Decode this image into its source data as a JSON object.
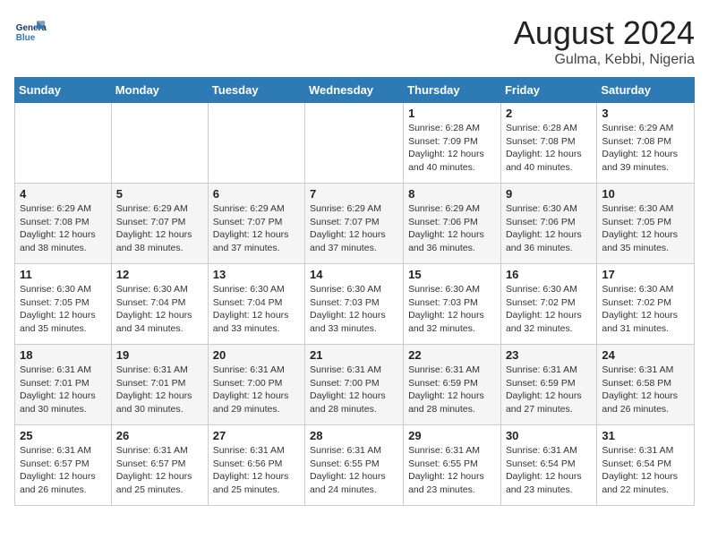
{
  "header": {
    "logo_line1": "General",
    "logo_line2": "Blue",
    "month_year": "August 2024",
    "location": "Gulma, Kebbi, Nigeria"
  },
  "days_of_week": [
    "Sunday",
    "Monday",
    "Tuesday",
    "Wednesday",
    "Thursday",
    "Friday",
    "Saturday"
  ],
  "weeks": [
    [
      {
        "day": "",
        "info": ""
      },
      {
        "day": "",
        "info": ""
      },
      {
        "day": "",
        "info": ""
      },
      {
        "day": "",
        "info": ""
      },
      {
        "day": "1",
        "info": "Sunrise: 6:28 AM\nSunset: 7:09 PM\nDaylight: 12 hours\nand 40 minutes."
      },
      {
        "day": "2",
        "info": "Sunrise: 6:28 AM\nSunset: 7:08 PM\nDaylight: 12 hours\nand 40 minutes."
      },
      {
        "day": "3",
        "info": "Sunrise: 6:29 AM\nSunset: 7:08 PM\nDaylight: 12 hours\nand 39 minutes."
      }
    ],
    [
      {
        "day": "4",
        "info": "Sunrise: 6:29 AM\nSunset: 7:08 PM\nDaylight: 12 hours\nand 38 minutes."
      },
      {
        "day": "5",
        "info": "Sunrise: 6:29 AM\nSunset: 7:07 PM\nDaylight: 12 hours\nand 38 minutes."
      },
      {
        "day": "6",
        "info": "Sunrise: 6:29 AM\nSunset: 7:07 PM\nDaylight: 12 hours\nand 37 minutes."
      },
      {
        "day": "7",
        "info": "Sunrise: 6:29 AM\nSunset: 7:07 PM\nDaylight: 12 hours\nand 37 minutes."
      },
      {
        "day": "8",
        "info": "Sunrise: 6:29 AM\nSunset: 7:06 PM\nDaylight: 12 hours\nand 36 minutes."
      },
      {
        "day": "9",
        "info": "Sunrise: 6:30 AM\nSunset: 7:06 PM\nDaylight: 12 hours\nand 36 minutes."
      },
      {
        "day": "10",
        "info": "Sunrise: 6:30 AM\nSunset: 7:05 PM\nDaylight: 12 hours\nand 35 minutes."
      }
    ],
    [
      {
        "day": "11",
        "info": "Sunrise: 6:30 AM\nSunset: 7:05 PM\nDaylight: 12 hours\nand 35 minutes."
      },
      {
        "day": "12",
        "info": "Sunrise: 6:30 AM\nSunset: 7:04 PM\nDaylight: 12 hours\nand 34 minutes."
      },
      {
        "day": "13",
        "info": "Sunrise: 6:30 AM\nSunset: 7:04 PM\nDaylight: 12 hours\nand 33 minutes."
      },
      {
        "day": "14",
        "info": "Sunrise: 6:30 AM\nSunset: 7:03 PM\nDaylight: 12 hours\nand 33 minutes."
      },
      {
        "day": "15",
        "info": "Sunrise: 6:30 AM\nSunset: 7:03 PM\nDaylight: 12 hours\nand 32 minutes."
      },
      {
        "day": "16",
        "info": "Sunrise: 6:30 AM\nSunset: 7:02 PM\nDaylight: 12 hours\nand 32 minutes."
      },
      {
        "day": "17",
        "info": "Sunrise: 6:30 AM\nSunset: 7:02 PM\nDaylight: 12 hours\nand 31 minutes."
      }
    ],
    [
      {
        "day": "18",
        "info": "Sunrise: 6:31 AM\nSunset: 7:01 PM\nDaylight: 12 hours\nand 30 minutes."
      },
      {
        "day": "19",
        "info": "Sunrise: 6:31 AM\nSunset: 7:01 PM\nDaylight: 12 hours\nand 30 minutes."
      },
      {
        "day": "20",
        "info": "Sunrise: 6:31 AM\nSunset: 7:00 PM\nDaylight: 12 hours\nand 29 minutes."
      },
      {
        "day": "21",
        "info": "Sunrise: 6:31 AM\nSunset: 7:00 PM\nDaylight: 12 hours\nand 28 minutes."
      },
      {
        "day": "22",
        "info": "Sunrise: 6:31 AM\nSunset: 6:59 PM\nDaylight: 12 hours\nand 28 minutes."
      },
      {
        "day": "23",
        "info": "Sunrise: 6:31 AM\nSunset: 6:59 PM\nDaylight: 12 hours\nand 27 minutes."
      },
      {
        "day": "24",
        "info": "Sunrise: 6:31 AM\nSunset: 6:58 PM\nDaylight: 12 hours\nand 26 minutes."
      }
    ],
    [
      {
        "day": "25",
        "info": "Sunrise: 6:31 AM\nSunset: 6:57 PM\nDaylight: 12 hours\nand 26 minutes."
      },
      {
        "day": "26",
        "info": "Sunrise: 6:31 AM\nSunset: 6:57 PM\nDaylight: 12 hours\nand 25 minutes."
      },
      {
        "day": "27",
        "info": "Sunrise: 6:31 AM\nSunset: 6:56 PM\nDaylight: 12 hours\nand 25 minutes."
      },
      {
        "day": "28",
        "info": "Sunrise: 6:31 AM\nSunset: 6:55 PM\nDaylight: 12 hours\nand 24 minutes."
      },
      {
        "day": "29",
        "info": "Sunrise: 6:31 AM\nSunset: 6:55 PM\nDaylight: 12 hours\nand 23 minutes."
      },
      {
        "day": "30",
        "info": "Sunrise: 6:31 AM\nSunset: 6:54 PM\nDaylight: 12 hours\nand 23 minutes."
      },
      {
        "day": "31",
        "info": "Sunrise: 6:31 AM\nSunset: 6:54 PM\nDaylight: 12 hours\nand 22 minutes."
      }
    ]
  ]
}
